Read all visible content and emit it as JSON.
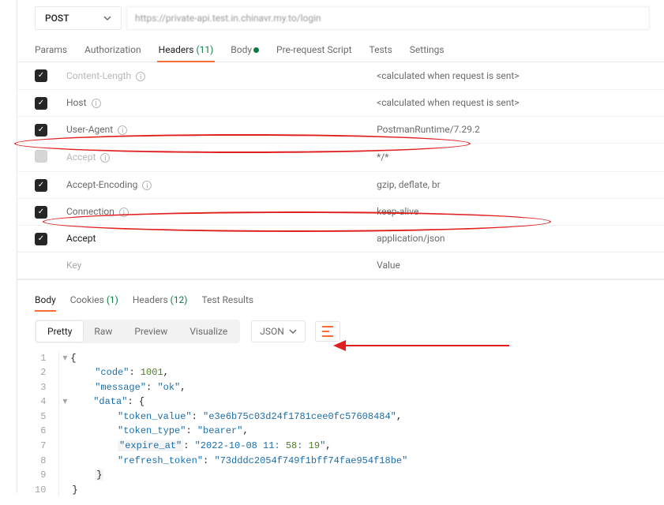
{
  "method": "POST",
  "url": "https://private-api.test.in.chinavr.my.to/login",
  "tabs": {
    "params": "Params",
    "authorization": "Authorization",
    "headers_label": "Headers",
    "headers_count": "(11)",
    "body": "Body",
    "prerequest": "Pre-request Script",
    "tests": "Tests",
    "settings": "Settings"
  },
  "headers": [
    {
      "checked": true,
      "dim": true,
      "key": "Content-Length",
      "info": true,
      "value": "<calculated when request is sent>"
    },
    {
      "checked": true,
      "dim": false,
      "key": "Host",
      "info": true,
      "value": "<calculated when request is sent>"
    },
    {
      "checked": true,
      "dim": false,
      "key": "User-Agent",
      "info": true,
      "value": "PostmanRuntime/7.29.2"
    },
    {
      "checked": false,
      "dim": true,
      "key": "Accept",
      "info": true,
      "value": "*/*",
      "dimchk": true
    },
    {
      "checked": true,
      "dim": false,
      "key": "Accept-Encoding",
      "info": true,
      "value": "gzip, deflate, br"
    },
    {
      "checked": true,
      "dim": false,
      "key": "Connection",
      "info": true,
      "value": "keep-alive"
    },
    {
      "checked": true,
      "dim": false,
      "key": "Accept",
      "info": false,
      "value": "application/json",
      "dark": true
    }
  ],
  "new_row": {
    "key_placeholder": "Key",
    "value_placeholder": "Value"
  },
  "response_tabs": {
    "body": "Body",
    "cookies": "Cookies",
    "cookies_count": "(1)",
    "headers": "Headers",
    "headers_count": "(12)",
    "test_results": "Test Results"
  },
  "viewmodes": {
    "pretty": "Pretty",
    "raw": "Raw",
    "preview": "Preview",
    "visualize": "Visualize",
    "lang": "JSON"
  },
  "json_lines": [
    "{",
    "    \"code\": 1001,",
    "    \"message\": \"ok\",",
    "    \"data\": {",
    "        \"token_value\": \"e3e6b75c03d24f1781cee0fc57608484\",",
    "        \"token_type\": \"bearer\",",
    "        \"expire_at\": \"2022-10-08 11:58:19\",",
    "        \"refresh_token\": \"73dddc2054f749f1bff74fae954f18be\"",
    "    }",
    "}"
  ],
  "json_body": {
    "code": 1001,
    "message": "ok",
    "data": {
      "token_value": "e3e6b75c03d24f1781cee0fc57608484",
      "token_type": "bearer",
      "expire_at": "2022-10-08 11:58:19",
      "refresh_token": "73dddc2054f749f1bff74fae954f18be"
    }
  }
}
